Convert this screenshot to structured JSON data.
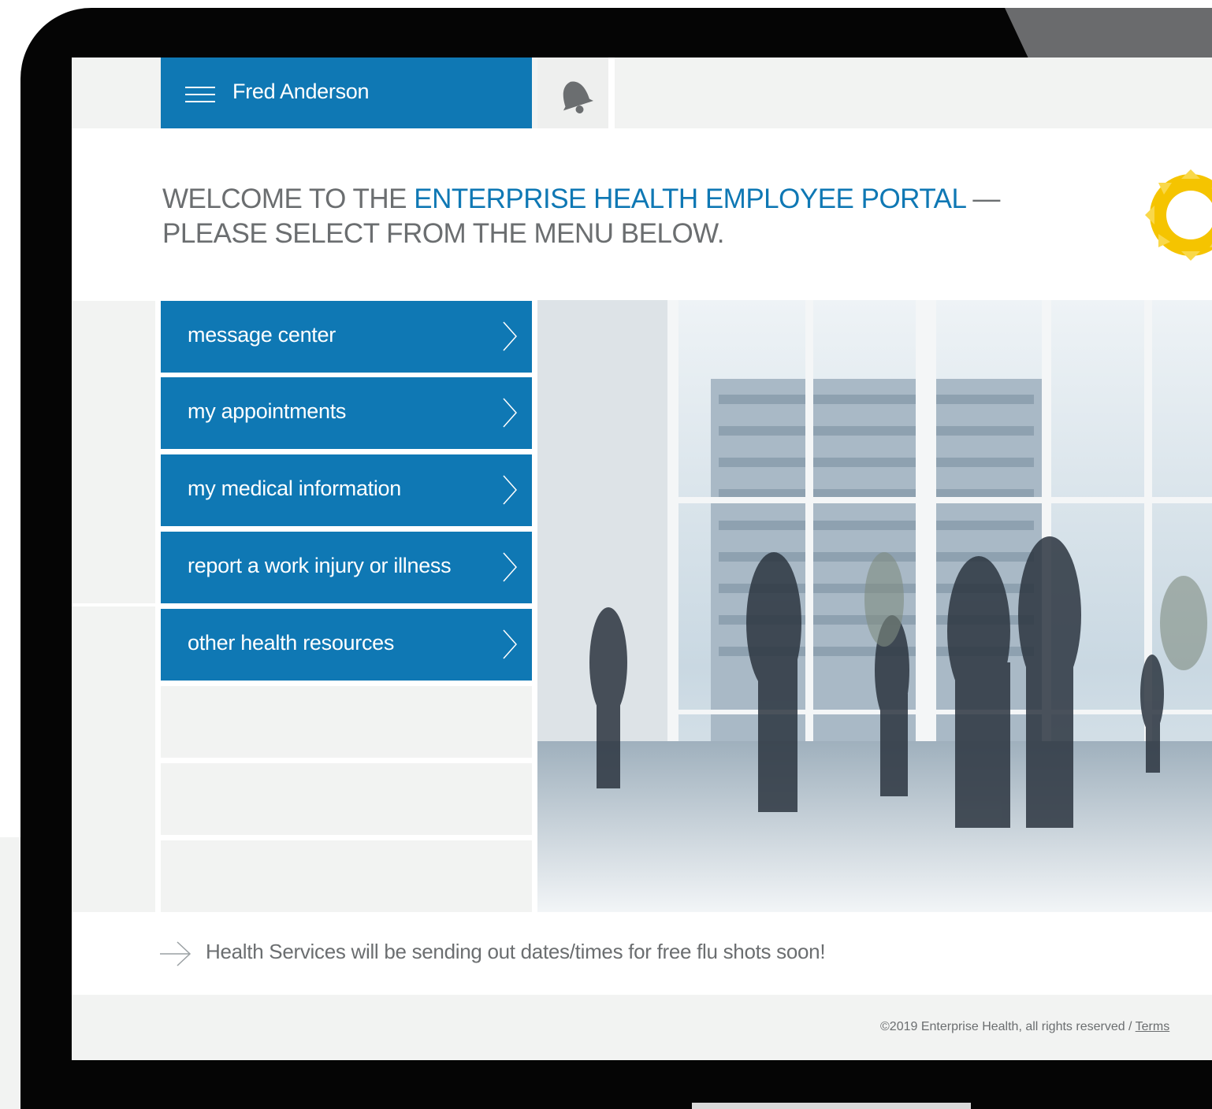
{
  "header": {
    "user_name": "Fred Anderson"
  },
  "welcome": {
    "line1_prefix": "WELCOME TO THE ",
    "line1_highlight": "ENTERPRISE HEALTH EMPLOYEE PORTAL",
    "line1_suffix": " —",
    "line2": "PLEASE SELECT FROM THE MENU BELOW."
  },
  "menu": {
    "items": [
      {
        "label": "message center"
      },
      {
        "label": "my appointments"
      },
      {
        "label": "my medical information"
      },
      {
        "label": "report a work injury or illness"
      },
      {
        "label": "other health resources"
      }
    ]
  },
  "announcement": "Health Services will be sending out dates/times for free flu shots soon!",
  "footer": {
    "copyright": "©2019 Enterprise Health, all rights reserved",
    "separator": " / ",
    "terms": "Terms"
  },
  "colors": {
    "accent": "#0f78b4",
    "panel": "#f2f3f2",
    "text": "#6b6e70",
    "logo": "#f5c400"
  },
  "icons": [
    "hamburger-icon",
    "bell-icon",
    "chevron-right-icon",
    "arrow-right-icon",
    "sun-logo-icon"
  ]
}
